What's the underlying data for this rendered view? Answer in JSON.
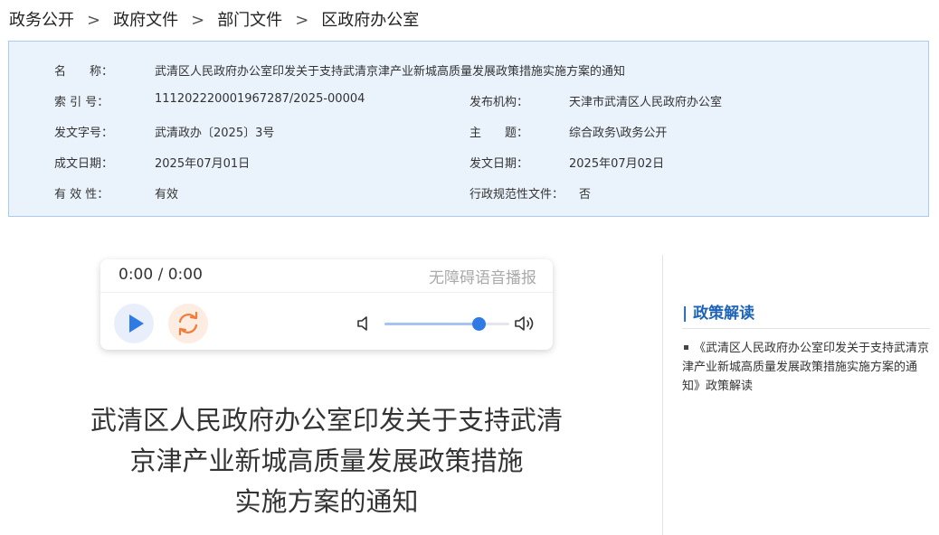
{
  "breadcrumb": {
    "items": [
      "政务公开",
      "政府文件",
      "部门文件",
      "区政府办公室"
    ],
    "separator": ">"
  },
  "meta": {
    "name_label": "名　　称：",
    "name_value": "武清区人民政府办公室印发关于支持武清京津产业新城高质量发展政策措施实施方案的通知",
    "index_label": "索 引 号：",
    "index_value": "111202220001967287/2025-00004",
    "publisher_label": "发布机构：",
    "publisher_value": "天津市武清区人民政府办公室",
    "doc_no_label": "发文字号：",
    "doc_no_value": "武清政办〔2025〕3号",
    "topic_label": "主　　题：",
    "topic_value": "综合政务\\政务公开",
    "written_label": "成文日期：",
    "written_value": "2025年07月01日",
    "issued_label": "发文日期：",
    "issued_value": "2025年07月02日",
    "validity_label": "有 效 性：",
    "validity_value": "有效",
    "normative_label": "行政规范性文件：",
    "normative_value": "否"
  },
  "player": {
    "time": "0:00 / 0:00",
    "accessibility_label": "无障碍语音播报",
    "volume_level": 0.75,
    "accent_color": "#2f7ae5",
    "reload_color": "#f07d3a",
    "icons": [
      "play-icon",
      "reload-icon",
      "volume-low-icon",
      "volume-high-icon"
    ]
  },
  "document": {
    "title_line1": "武清区人民政府办公室印发关于支持武清",
    "title_line2": "京津产业新城高质量发展政策措施",
    "title_line3": "实施方案的通知"
  },
  "sidebar": {
    "heading": "| 政策解读",
    "items": [
      {
        "label": "《武清区人民政府办公室印发关于支持武清京津产业新城高质量发展政策措施实施方案的通知》政策解读"
      }
    ]
  },
  "colors": {
    "meta_bg": "#eaf3fc",
    "meta_border": "#a9cdee",
    "sidebar_heading": "#1e63b6"
  }
}
